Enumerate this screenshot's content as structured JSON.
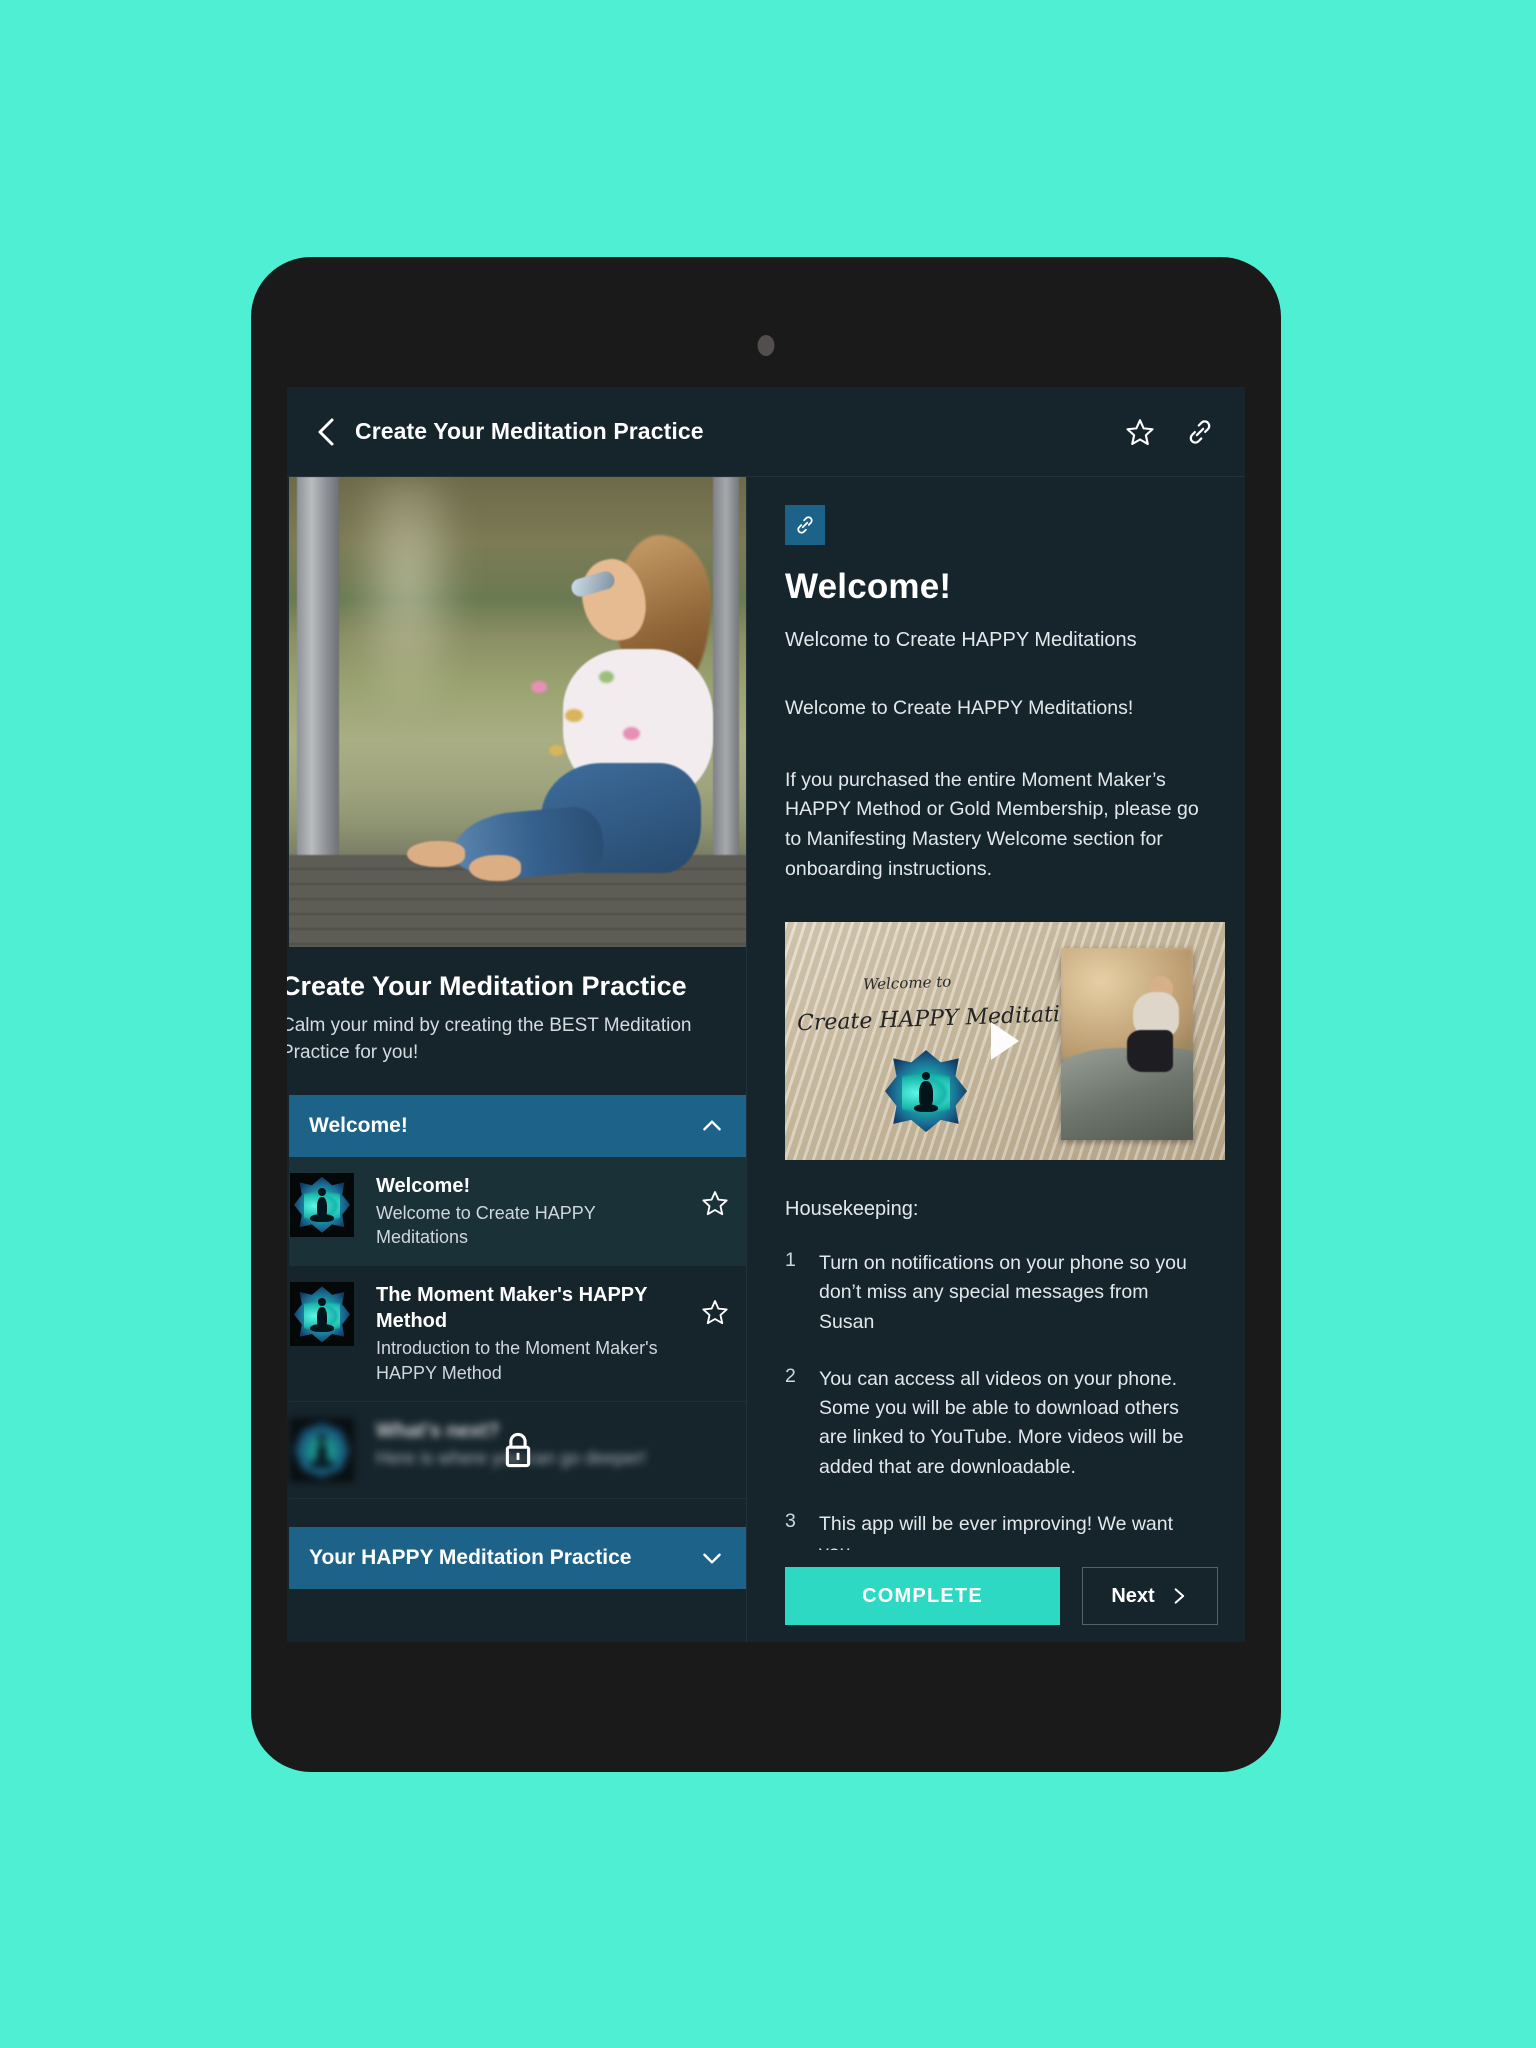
{
  "app": {
    "header": {
      "title": "Create Your Meditation Practice",
      "back_icon": "chevron-left-icon",
      "favorite_icon": "star-outline-icon",
      "share_icon": "link-icon"
    }
  },
  "left_panel": {
    "hero_image_alt": "woman sitting on dock by water",
    "course_title": "Create Your Meditation Practice",
    "course_subtitle": "Calm your mind by creating the BEST Meditation Practice for you!",
    "sections": [
      {
        "label": "Welcome!",
        "expanded": true,
        "chevron": "chevron-up-icon",
        "lessons": [
          {
            "title": "Welcome!",
            "desc": "Welcome to Create HAPPY Meditations",
            "selected": true,
            "locked": false,
            "star_icon": "star-outline-icon"
          },
          {
            "title": "The Moment Maker's HAPPY Method",
            "desc": "Introduction to the Moment Maker's HAPPY Method",
            "selected": false,
            "locked": false,
            "star_icon": "star-outline-icon"
          },
          {
            "title": "What's next?",
            "desc": "Here is where you can go deeper!",
            "selected": false,
            "locked": true,
            "lock_icon": "lock-icon"
          }
        ]
      },
      {
        "label": "Your HAPPY Meditation Practice",
        "expanded": false,
        "chevron": "chevron-down-icon",
        "lessons": []
      }
    ]
  },
  "right_panel": {
    "link_chip_icon": "link-icon",
    "heading": "Welcome!",
    "subheading": "Welcome to Create HAPPY Meditations",
    "paragraphs": [
      "Welcome to Create HAPPY Meditations!",
      "If you purchased the entire Moment Maker’s HAPPY Method or Gold Membership, please go to Manifesting Mastery Welcome section for onboarding instructions."
    ],
    "video": {
      "line1": "Welcome to",
      "line2": "Create HAPPY Meditations",
      "play_icon": "play-icon"
    },
    "housekeeping_label": "Housekeeping:",
    "housekeeping": [
      {
        "num": "1",
        "text": "Turn on notifications on your phone so you don’t miss any special messages from Susan"
      },
      {
        "num": "2",
        "text": "You can access all videos on your phone. Some you will be able to download others are linked to YouTube. More videos will be added that are downloadable."
      },
      {
        "num": "3",
        "text": "This app will be ever improving! We want you"
      }
    ],
    "actions": {
      "complete_label": "COMPLETE",
      "next_label": "Next",
      "next_icon": "chevron-right-icon"
    }
  },
  "colors": {
    "page_background": "#4FEFD4",
    "device_body": "#1A1A1A",
    "screen_background": "#16242C",
    "accent_blue": "#1D6389",
    "accent_teal": "#2ED9C3",
    "selected_row": "#1B3138"
  }
}
